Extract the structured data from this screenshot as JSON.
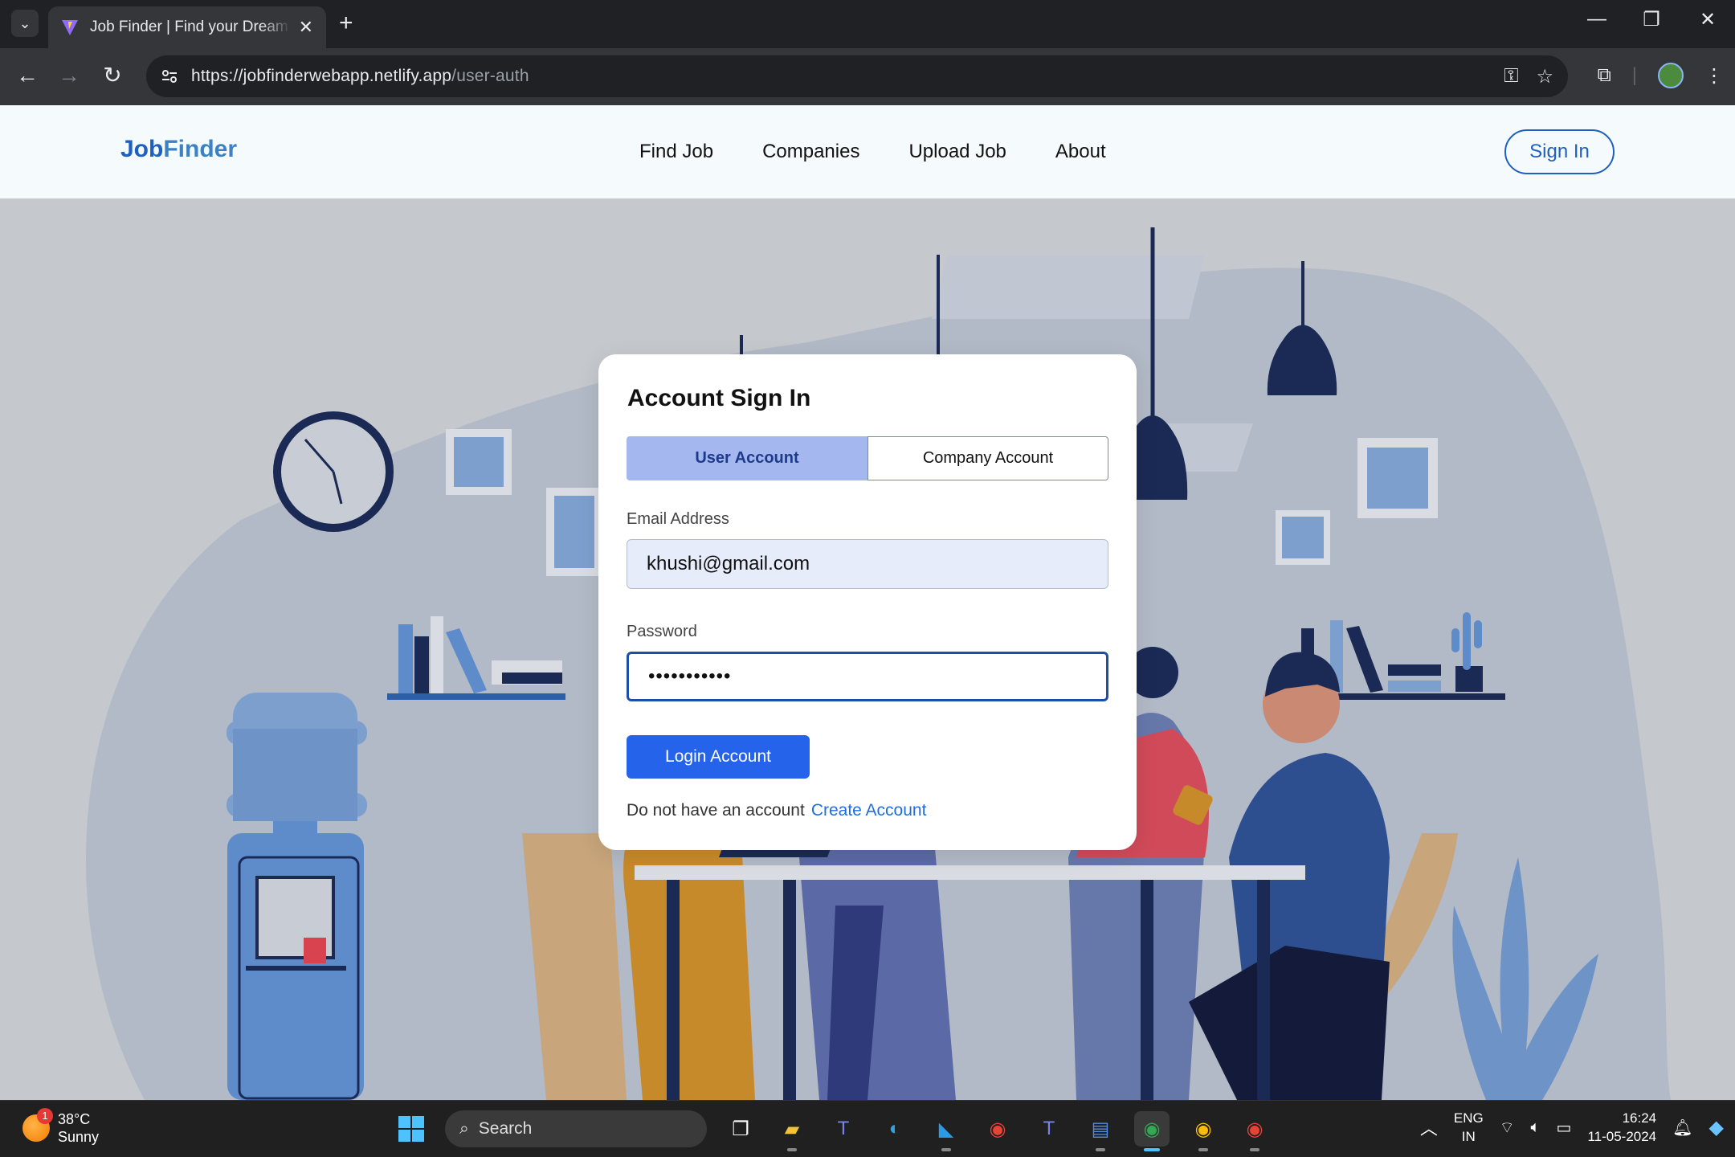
{
  "browser": {
    "tab_title": "Job Finder | Find your Dream Jo",
    "url_host": "https://jobfinderwebapp.netlify.app",
    "url_path": "/user-auth"
  },
  "site": {
    "logo_part1": "Job",
    "logo_part2": "Finder",
    "nav": [
      "Find Job",
      "Companies",
      "Upload Job",
      "About"
    ],
    "signin_label": "Sign In"
  },
  "form": {
    "title": "Account Sign In",
    "tab_user": "User Account",
    "tab_company": "Company Account",
    "email_label": "Email Address",
    "email_value": "khushi@gmail.com",
    "password_label": "Password",
    "password_value": "•••••••••••",
    "login_label": "Login Account",
    "signup_prompt": "Do not have an account",
    "signup_link": "Create Account"
  },
  "taskbar": {
    "temp": "38°C",
    "condition": "Sunny",
    "weather_badge": "1",
    "search_label": "Search",
    "lang1": "ENG",
    "lang2": "IN",
    "time": "16:24",
    "date": "11-05-2024"
  },
  "colors": {
    "brand": "#1e5fbf",
    "primary_button": "#2563eb",
    "active_tab": "#a4b8ef"
  }
}
